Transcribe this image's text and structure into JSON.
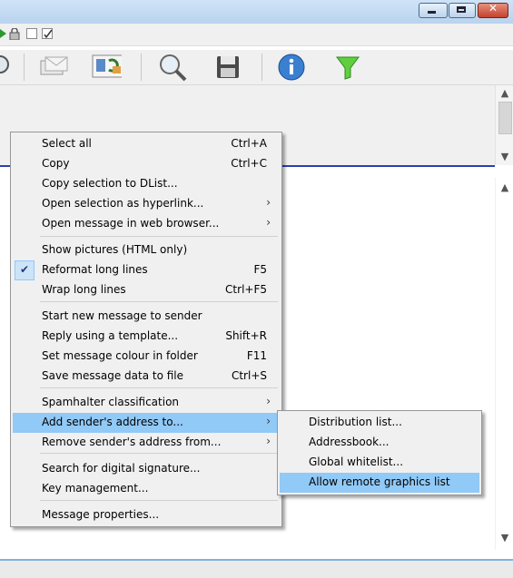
{
  "window": {
    "minimize_glyph": "",
    "maximize_glyph": "",
    "close_glyph": "✕"
  },
  "toolbar": {
    "icons": [
      "search-icon",
      "addressbook-icon",
      "find-icon",
      "save-icon",
      "info-icon",
      "filter-icon"
    ]
  },
  "context_menu": {
    "items": [
      {
        "label": "Select all",
        "shortcut": "Ctrl+A"
      },
      {
        "label": "Copy",
        "shortcut": "Ctrl+C"
      },
      {
        "label": "Copy selection to DList...",
        "shortcut": ""
      },
      {
        "label": "Open selection as hyperlink...",
        "shortcut": "",
        "submenu": true
      },
      {
        "label": "Open message in web browser...",
        "shortcut": "",
        "submenu": true
      },
      {
        "label": "Show pictures (HTML only)",
        "shortcut": ""
      },
      {
        "label": "Reformat long lines",
        "shortcut": "F5",
        "checked": true
      },
      {
        "label": "Wrap long lines",
        "shortcut": "Ctrl+F5"
      },
      {
        "label": "Start new message to sender",
        "shortcut": ""
      },
      {
        "label": "Reply using a template...",
        "shortcut": "Shift+R"
      },
      {
        "label": "Set message colour in folder",
        "shortcut": "F11"
      },
      {
        "label": "Save message data to file",
        "shortcut": "Ctrl+S"
      },
      {
        "label": "Spamhalter classification",
        "shortcut": "",
        "submenu": true
      },
      {
        "label": "Add sender's address to...",
        "shortcut": "",
        "submenu": true,
        "highlighted": true
      },
      {
        "label": "Remove sender's address from...",
        "shortcut": "",
        "submenu": true
      },
      {
        "label": "Search for digital signature...",
        "shortcut": ""
      },
      {
        "label": "Key management...",
        "shortcut": ""
      },
      {
        "label": "Message properties...",
        "shortcut": ""
      }
    ],
    "submenu_arrow": "›",
    "check_glyph": "✔"
  },
  "submenu": {
    "items": [
      {
        "label": "Distribution list..."
      },
      {
        "label": "Addressbook..."
      },
      {
        "label": "Global whitelist..."
      },
      {
        "label": "Allow remote graphics list",
        "highlighted": true
      }
    ]
  },
  "scrollbar": {
    "up": "▲",
    "down": "▼"
  },
  "colors": {
    "highlight": "#91c9f7",
    "divider": "#2a3fb0"
  }
}
